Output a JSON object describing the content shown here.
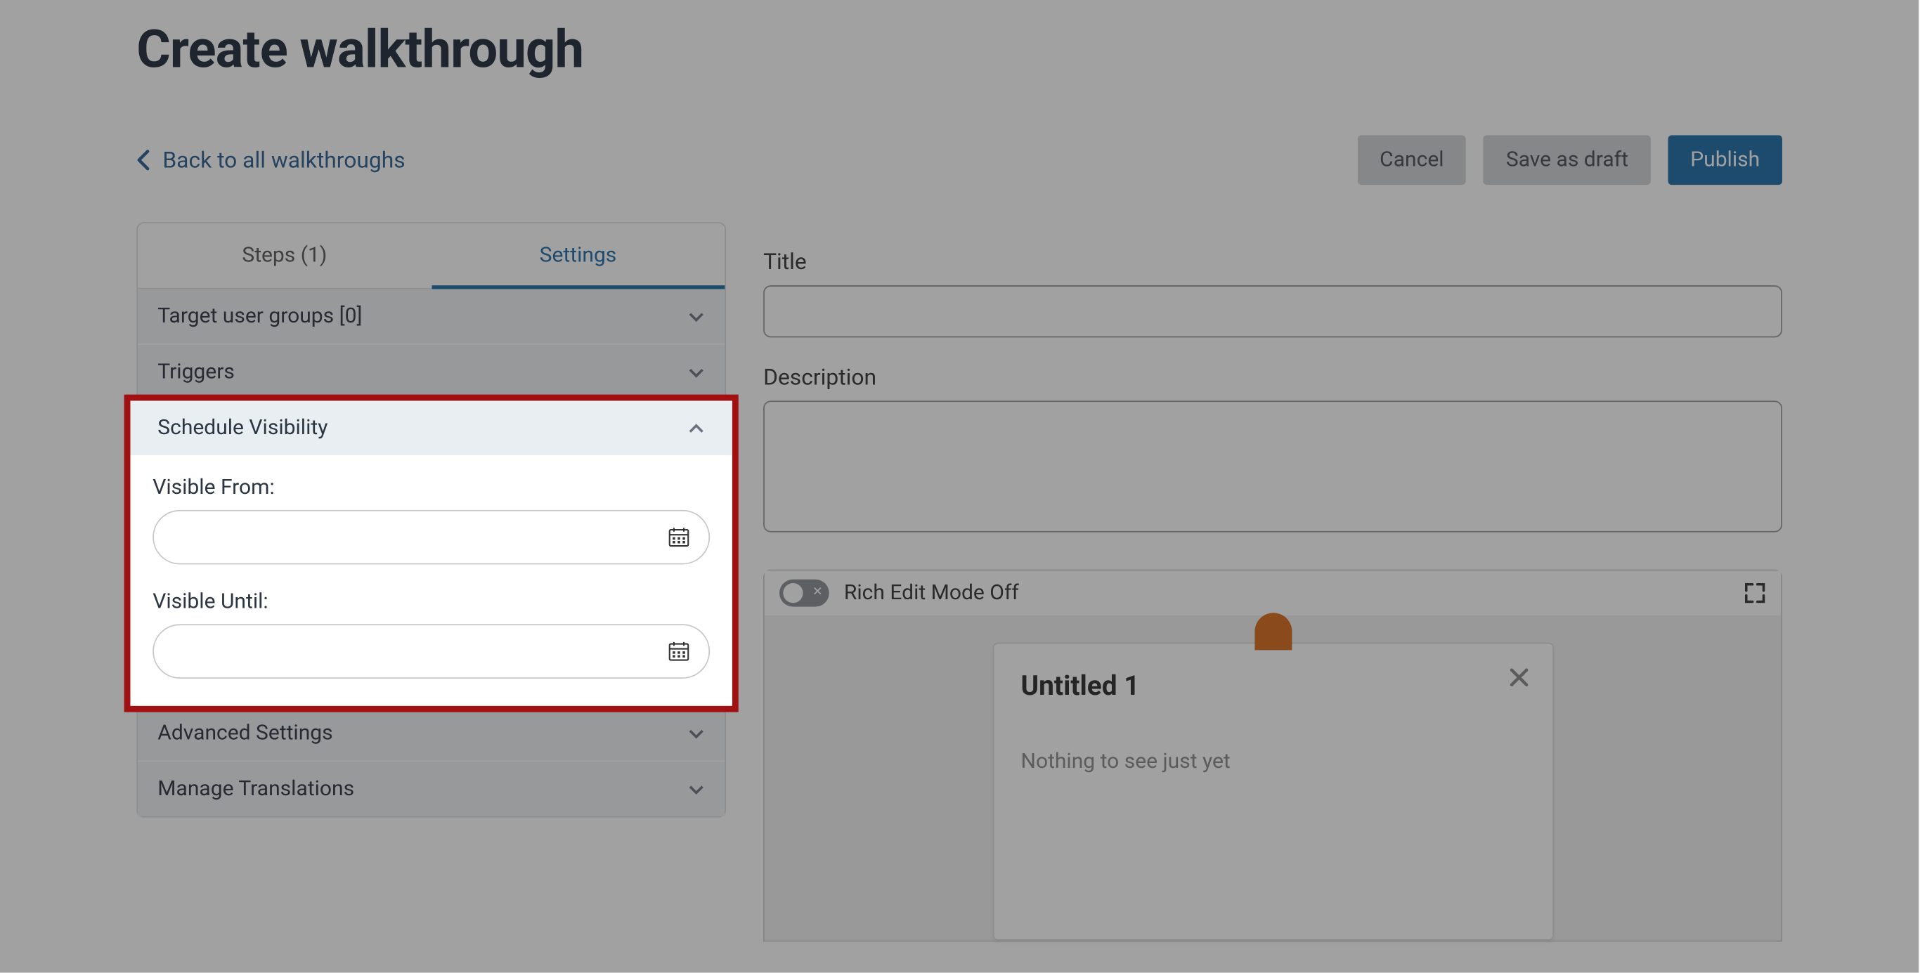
{
  "page": {
    "title": "Create walkthrough",
    "back_link": "Back to all walkthroughs"
  },
  "actions": {
    "cancel": "Cancel",
    "save_draft": "Save as draft",
    "publish": "Publish"
  },
  "tabs": {
    "steps": "Steps (1)",
    "settings": "Settings"
  },
  "sidebar": {
    "target_user_groups": "Target user groups [0]",
    "triggers": "Triggers",
    "schedule_visibility": "Schedule Visibility",
    "visible_from_label": "Visible From:",
    "visible_from_value": "",
    "visible_until_label": "Visible Until:",
    "visible_until_value": "",
    "advanced_settings": "Advanced Settings",
    "manage_translations": "Manage Translations"
  },
  "form": {
    "title_label": "Title",
    "title_value": "",
    "description_label": "Description",
    "description_value": ""
  },
  "preview": {
    "rich_edit_label": "Rich Edit Mode Off",
    "card_title": "Untitled 1",
    "card_body": "Nothing to see just yet"
  }
}
